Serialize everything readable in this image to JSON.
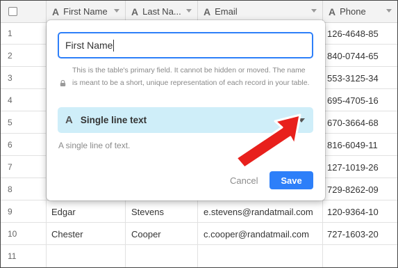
{
  "columns": [
    {
      "type_icon": "",
      "label": ""
    },
    {
      "type_icon": "A",
      "label": "First Name"
    },
    {
      "type_icon": "A",
      "label": "Last Na..."
    },
    {
      "type_icon": "A",
      "label": "Email"
    },
    {
      "type_icon": "A",
      "label": "Phone"
    }
  ],
  "rows": [
    {
      "num": "1",
      "first": "",
      "last": "",
      "email": "",
      "phone": "126-4648-85"
    },
    {
      "num": "2",
      "first": "",
      "last": "",
      "email": "",
      "phone": "840-0744-65"
    },
    {
      "num": "3",
      "first": "",
      "last": "",
      "email": "",
      "phone": "553-3125-34"
    },
    {
      "num": "4",
      "first": "",
      "last": "",
      "email": "",
      "phone": "695-4705-16"
    },
    {
      "num": "5",
      "first": "",
      "last": "",
      "email": "",
      "phone": "670-3664-68"
    },
    {
      "num": "6",
      "first": "",
      "last": "",
      "email": "",
      "phone": "816-6049-11"
    },
    {
      "num": "7",
      "first": "",
      "last": "",
      "email": "",
      "phone": "127-1019-26"
    },
    {
      "num": "8",
      "first": "",
      "last": "",
      "email": "",
      "phone": "729-8262-09"
    },
    {
      "num": "9",
      "first": "Edgar",
      "last": "Stevens",
      "email": "e.stevens@randatmail.com",
      "phone": "120-9364-10"
    },
    {
      "num": "10",
      "first": "Chester",
      "last": "Cooper",
      "email": "c.cooper@randatmail.com",
      "phone": "727-1603-20"
    },
    {
      "num": "11",
      "first": "",
      "last": "",
      "email": "",
      "phone": ""
    }
  ],
  "popup": {
    "field_name_value": "First Name",
    "primary_note": "This is the table's primary field. It cannot be hidden or moved. The name is meant to be a short, unique representation of each record in your table.",
    "field_type_icon": "A",
    "field_type_label": "Single line text",
    "field_type_description": "A single line of text.",
    "cancel_label": "Cancel",
    "save_label": "Save"
  },
  "colors": {
    "accent": "#2d7ff9",
    "type_select_bg": "#cfeef9",
    "annotation_arrow": "#e8201c"
  }
}
